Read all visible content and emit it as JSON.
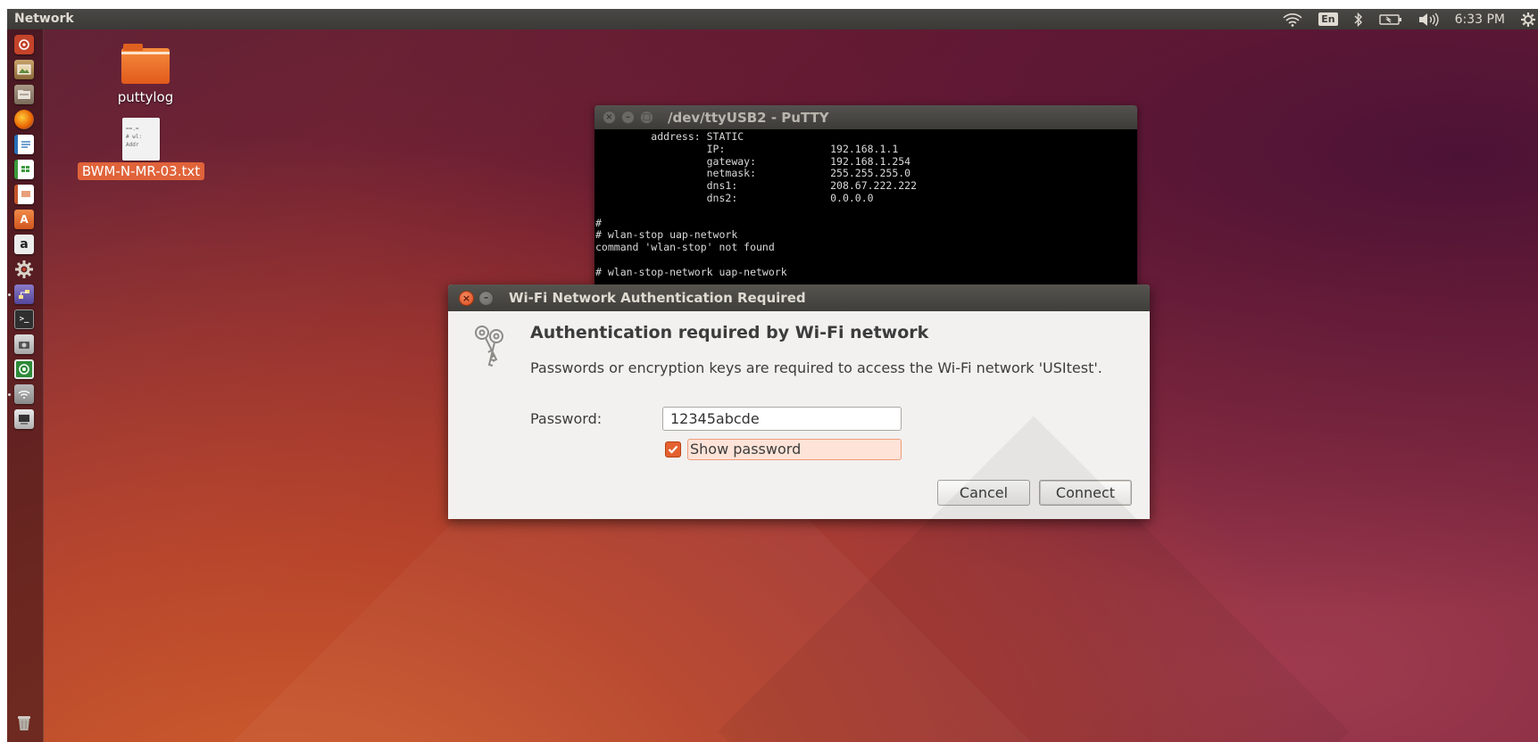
{
  "top_panel": {
    "app_name": "Network",
    "indicators": {
      "wifi_icon": "wifi-icon",
      "keyboard_layout": "En",
      "bluetooth_icon": "bluetooth-icon",
      "battery_icon": "battery-icon",
      "volume_icon": "volume-icon",
      "clock": "6:33 PM",
      "settings_icon": "gear-icon"
    }
  },
  "launcher": {
    "items": [
      {
        "name": "dash-home",
        "color": "#c4432a"
      },
      {
        "name": "image-viewer",
        "color": "#8c7b5a"
      },
      {
        "name": "file-manager",
        "color": "#8a7a6a"
      },
      {
        "name": "firefox",
        "color": "#e66000"
      },
      {
        "name": "libreoffice-writer",
        "color": "#2a6fb8"
      },
      {
        "name": "libreoffice-calc",
        "color": "#3b9a3b"
      },
      {
        "name": "libreoffice-impress",
        "color": "#c4542a"
      },
      {
        "name": "software-center",
        "color": "#e06a2c"
      },
      {
        "name": "amazon",
        "color": "#e9e9e9"
      },
      {
        "name": "system-settings",
        "color": "#b8b0a8"
      },
      {
        "name": "network-tool",
        "color": "#6f60a8"
      },
      {
        "name": "terminal",
        "color": "#3a3a3a"
      },
      {
        "name": "screenshot",
        "color": "#aaaaaa"
      },
      {
        "name": "cheese",
        "color": "#2f8a3a"
      },
      {
        "name": "network-manager",
        "color": "#9a9a9a"
      },
      {
        "name": "putty",
        "color": "#d8d8d8"
      }
    ],
    "trash": "trash-icon"
  },
  "desktop_icons": [
    {
      "label": "puttylog",
      "icon": "folder-icon"
    },
    {
      "label": "BWM-N-MR-03.txt",
      "icon": "text-file-icon"
    }
  ],
  "putty": {
    "title": "/dev/ttyUSB2 - PuTTY",
    "lines": [
      "         address: STATIC",
      "                  IP:                 192.168.1.1",
      "                  gateway:            192.168.1.254",
      "                  netmask:            255.255.255.0",
      "                  dns1:               208.67.222.222",
      "                  dns2:               0.0.0.0",
      "",
      "#",
      "# wlan-stop uap-network",
      "command 'wlan-stop' not found",
      "",
      "# wlan-stop-network uap-network"
    ]
  },
  "dialog": {
    "title": "Wi-Fi Network Authentication Required",
    "heading": "Authentication required by Wi-Fi network",
    "message": "Passwords or encryption keys are required to access the Wi-Fi network 'USItest'.",
    "password_label": "Password:",
    "password_value": "12345abcde",
    "show_password_label": "Show password",
    "show_password_checked": true,
    "cancel_label": "Cancel",
    "connect_label": "Connect"
  },
  "colors": {
    "accent": "#e4602f",
    "panel": "#3b3a37",
    "dialog_bg": "#f2f1f0"
  }
}
